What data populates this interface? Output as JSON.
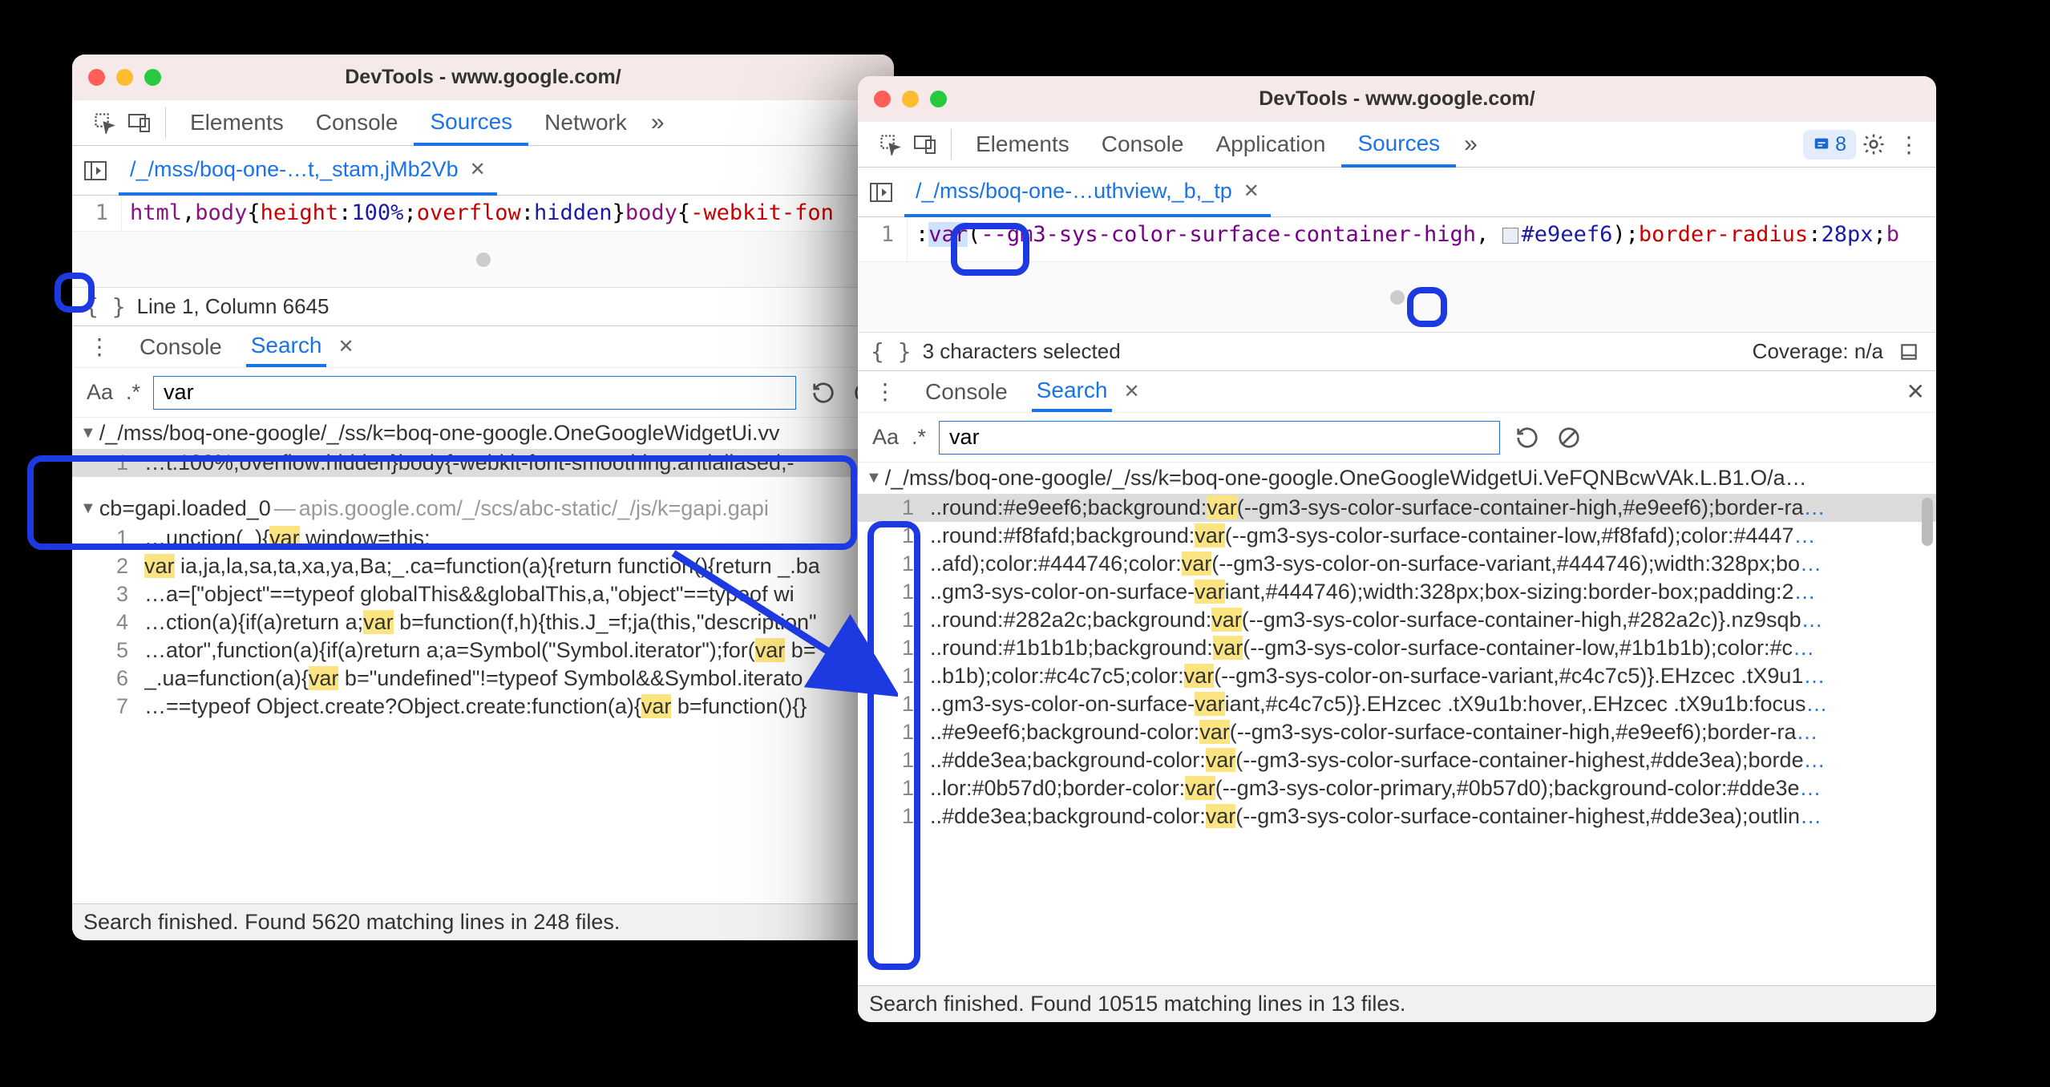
{
  "left": {
    "title": "DevTools - www.google.com/",
    "tabs": [
      "Elements",
      "Console",
      "Sources",
      "Network"
    ],
    "active_tab": "Sources",
    "file_tab": "/_/mss/boq-one-…t,_stam,jMb2Vb",
    "code": {
      "line_no": "1",
      "seg_tag1": "html",
      "seg_comma": ",",
      "seg_tag2": "body",
      "seg_open": "{",
      "seg_prop1": "height",
      "seg_colon": ":",
      "seg_val1": "100%",
      "seg_semi": ";",
      "seg_prop2": "overflow",
      "seg_val2": "hidden",
      "seg_close": "}",
      "seg_tag3": "body",
      "seg_open2": "{",
      "seg_prop3": "-webkit-fon"
    },
    "status": "Line 1, Column 6645",
    "drawer_tabs": [
      "Console",
      "Search"
    ],
    "drawer_active": "Search",
    "search": {
      "case": "Aa",
      "regex": ".*",
      "value": "var"
    },
    "results": {
      "file1": "/_/mss/boq-one-google/_/ss/k=boq-one-google.OneGoogleWidgetUi.vv",
      "file1_line": {
        "n": "1",
        "text": "…t:100%;overflow:hidden}body{-webkit-font-smoothing:antialiased;-"
      },
      "file2_main": "cb=gapi.loaded_0",
      "file2_dim": "apis.google.com/_/scs/abc-static/_/js/k=gapi.gapi",
      "lines": [
        {
          "n": "1",
          "pre": "…unction(_){",
          "hl": "var",
          "post": " window=this;"
        },
        {
          "n": "2",
          "pre": "",
          "hl": "var",
          "post": " ia,ja,la,sa,ta,xa,ya,Ba;_.ca=function(a){return function(){return _.ba"
        },
        {
          "n": "3",
          "pre": "…a=[\"object\"==typeof globalThis&&globalThis,a,\"object\"==typeof wi",
          "hl": "",
          "post": ""
        },
        {
          "n": "4",
          "pre": "…ction(a){if(a)return a;",
          "hl": "var",
          "post": " b=function(f,h){this.J_=f;ja(this,\"description\""
        },
        {
          "n": "5",
          "pre": "…ator\",function(a){if(a)return a;a=Symbol(\"Symbol.iterator\");for(",
          "hl": "var",
          "post": " b="
        },
        {
          "n": "6",
          "pre": "_.ua=function(a){",
          "hl": "var",
          "post": " b=\"undefined\"!=typeof Symbol&&Symbol.iterato"
        },
        {
          "n": "7",
          "pre": "…==typeof Object.create?Object.create:function(a){",
          "hl": "var",
          "post": " b=function(){}"
        }
      ]
    },
    "footer": "Search finished.  Found 5620 matching lines in 248 files."
  },
  "right": {
    "title": "DevTools - www.google.com/",
    "tabs": [
      "Elements",
      "Console",
      "Application",
      "Sources"
    ],
    "active_tab": "Sources",
    "badge": "8",
    "file_tab": "/_/mss/boq-one-…uthview,_b,_tp",
    "code": {
      "line_no": "1",
      "pre": ":",
      "kw": "var",
      "open": "(",
      "varname": "--gm3-sys-color-surface-container-high",
      "comma": ", ",
      "hex": "#e9eef6",
      "close": ");",
      "prop": "border-radius",
      "colon": ":",
      "val": "28px",
      "semi": ";",
      "trail": "b"
    },
    "status_left": "3 characters selected",
    "status_right": "Coverage: n/a",
    "drawer_tabs": [
      "Console",
      "Search"
    ],
    "drawer_active": "Search",
    "search": {
      "case": "Aa",
      "regex": ".*",
      "value": "var"
    },
    "results": {
      "file1": "/_/mss/boq-one-google/_/ss/k=boq-one-google.OneGoogleWidgetUi.VeFQNBcwVAk.L.B1.O/a…",
      "lines": [
        {
          "n": "1",
          "pre": "..round:#e9eef6;background:",
          "hl": "var",
          "post": "(--gm3-sys-color-surface-container-high,#e9eef6);border-ra",
          "sel": true
        },
        {
          "n": "1",
          "pre": "..round:#f8fafd;background:",
          "hl": "var",
          "post": "(--gm3-sys-color-surface-container-low,#f8fafd);color:#4447"
        },
        {
          "n": "1",
          "pre": "..afd);color:#444746;color:",
          "hl": "var",
          "post": "(--gm3-sys-color-on-surface-variant,#444746);width:328px;bo"
        },
        {
          "n": "1",
          "pre": "..gm3-sys-color-on-surface-",
          "hl": "var",
          "post": "iant,#444746);width:328px;box-sizing:border-box;padding:2"
        },
        {
          "n": "1",
          "pre": "..round:#282a2c;background:",
          "hl": "var",
          "post": "(--gm3-sys-color-surface-container-high,#282a2c)}.nz9sqb"
        },
        {
          "n": "1",
          "pre": "..round:#1b1b1b;background:",
          "hl": "var",
          "post": "(--gm3-sys-color-surface-container-low,#1b1b1b);color:#c"
        },
        {
          "n": "1",
          "pre": "..b1b);color:#c4c7c5;color:",
          "hl": "var",
          "post": "(--gm3-sys-color-on-surface-variant,#c4c7c5)}.EHzcec .tX9u1"
        },
        {
          "n": "1",
          "pre": "..gm3-sys-color-on-surface-",
          "hl": "var",
          "post": "iant,#c4c7c5)}.EHzcec .tX9u1b:hover,.EHzcec .tX9u1b:focus"
        },
        {
          "n": "1",
          "pre": "..#e9eef6;background-color:",
          "hl": "var",
          "post": "(--gm3-sys-color-surface-container-high,#e9eef6);border-ra"
        },
        {
          "n": "1",
          "pre": "..#dde3ea;background-color:",
          "hl": "var",
          "post": "(--gm3-sys-color-surface-container-highest,#dde3ea);borde"
        },
        {
          "n": "1",
          "pre": "..lor:#0b57d0;border-color:",
          "hl": "var",
          "post": "(--gm3-sys-color-primary,#0b57d0);background-color:#dde3e"
        },
        {
          "n": "1",
          "pre": "..#dde3ea;background-color:",
          "hl": "var",
          "post": "(--gm3-sys-color-surface-container-highest,#dde3ea);outlin"
        }
      ]
    },
    "footer": "Search finished.  Found 10515 matching lines in 13 files."
  }
}
